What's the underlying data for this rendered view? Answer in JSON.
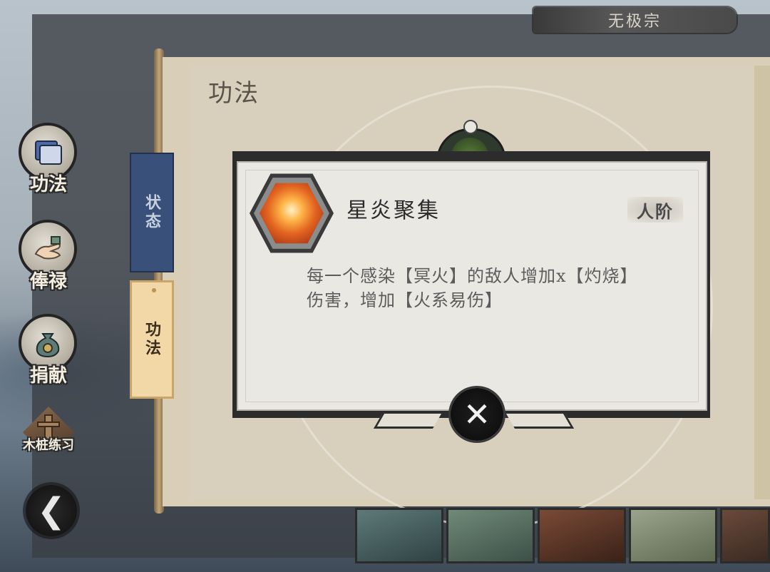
{
  "header": {
    "sect_name": "无极宗"
  },
  "page": {
    "title": "功法"
  },
  "tabs": [
    {
      "label": "状态"
    },
    {
      "label": "功法"
    }
  ],
  "side_menu": [
    {
      "label": "功法",
      "icon": "scroll-book-icon"
    },
    {
      "label": "俸禄",
      "icon": "open-hand-icon"
    },
    {
      "label": "捐献",
      "icon": "money-bag-icon"
    },
    {
      "label": "木桩练习",
      "icon": "wooden-dummy-icon"
    }
  ],
  "back_button": {
    "icon": "back-arrow-icon",
    "glyph": "❮"
  },
  "skill_popup": {
    "name": "星炎聚集",
    "rank": "人阶",
    "icon": "star-flame-icon",
    "description": "每一个感染【冥火】的敌人增加x【灼烧】伤害，增加【火系易伤】",
    "close_icon": "close-icon",
    "close_glyph": "✕"
  },
  "colors": {
    "status_tab": "#38507a",
    "active_tab": "#f2d8a6",
    "scroll_paper": "#d8d0bd",
    "popup_bg": "#eae8e2"
  }
}
